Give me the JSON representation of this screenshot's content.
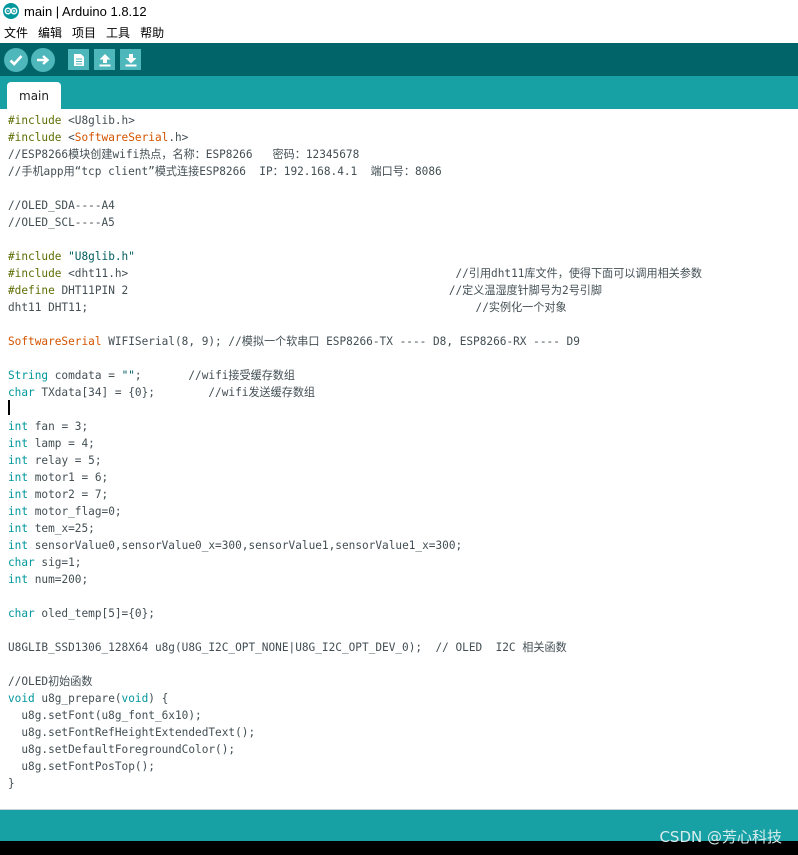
{
  "window": {
    "title": "main | Arduino 1.8.12",
    "logo_icon": "arduino-logo-icon"
  },
  "menubar": {
    "items": [
      "文件",
      "编辑",
      "项目",
      "工具",
      "帮助"
    ]
  },
  "toolbar": {
    "buttons": [
      "verify-icon",
      "upload-icon",
      "new-icon",
      "open-icon",
      "save-icon"
    ]
  },
  "tabs": [
    {
      "label": "main",
      "active": true
    }
  ],
  "colors": {
    "toolbar_bg": "#006468",
    "tabbar_bg": "#17a1a5",
    "button_bg": "#4db7bb",
    "keyword": "#00979c",
    "preprocessor": "#5e6d03",
    "class": "#d35400"
  },
  "code": {
    "lines": [
      "#include <U8glib.h>",
      "#include <SoftwareSerial.h>",
      "//ESP8266模块创建wifi热点，名称：ESP8266   密码：12345678",
      "//手机app用“tcp client”模式连接ESP8266  IP：192.168.4.1  端口号：8086",
      "",
      "//OLED_SDA----A4",
      "//OLED_SCL----A5",
      "",
      "#include \"U8glib.h\"",
      "#include <dht11.h>                                                 //引用dht11库文件，使得下面可以调用相关参数",
      "#define DHT11PIN 2                                                //定义温湿度针脚号为2号引脚",
      "dht11 DHT11;                                                          //实例化一个对象",
      "",
      "SoftwareSerial WIFISerial(8, 9); //模拟一个软串口 ESP8266-TX ---- D8, ESP8266-RX ---- D9",
      "",
      "String comdata = \"\";       //wifi接受缓存数组",
      "char TXdata[34] = {0};        //wifi发送缓存数组",
      "",
      "int fan = 3;",
      "int lamp = 4;",
      "int relay = 5;",
      "int motor1 = 6;",
      "int motor2 = 7;",
      "int motor_flag=0;",
      "int tem_x=25;",
      "int sensorValue0,sensorValue0_x=300,sensorValue1,sensorValue1_x=300;",
      "char sig=1;",
      "int num=200;",
      "",
      "char oled_temp[5]={0};",
      "",
      "U8GLIB_SSD1306_128X64 u8g(U8G_I2C_OPT_NONE|U8G_I2C_OPT_DEV_0);  // OLED  I2C 相关函数",
      "",
      "//OLED初始函数",
      "void u8g_prepare(void) {",
      "  u8g.setFont(u8g_font_6x10);",
      "  u8g.setFontRefHeightExtendedText();",
      "  u8g.setDefaultForegroundColor();",
      "  u8g.setFontPosTop();",
      "}"
    ]
  },
  "watermark": "CSDN @芳心科技"
}
